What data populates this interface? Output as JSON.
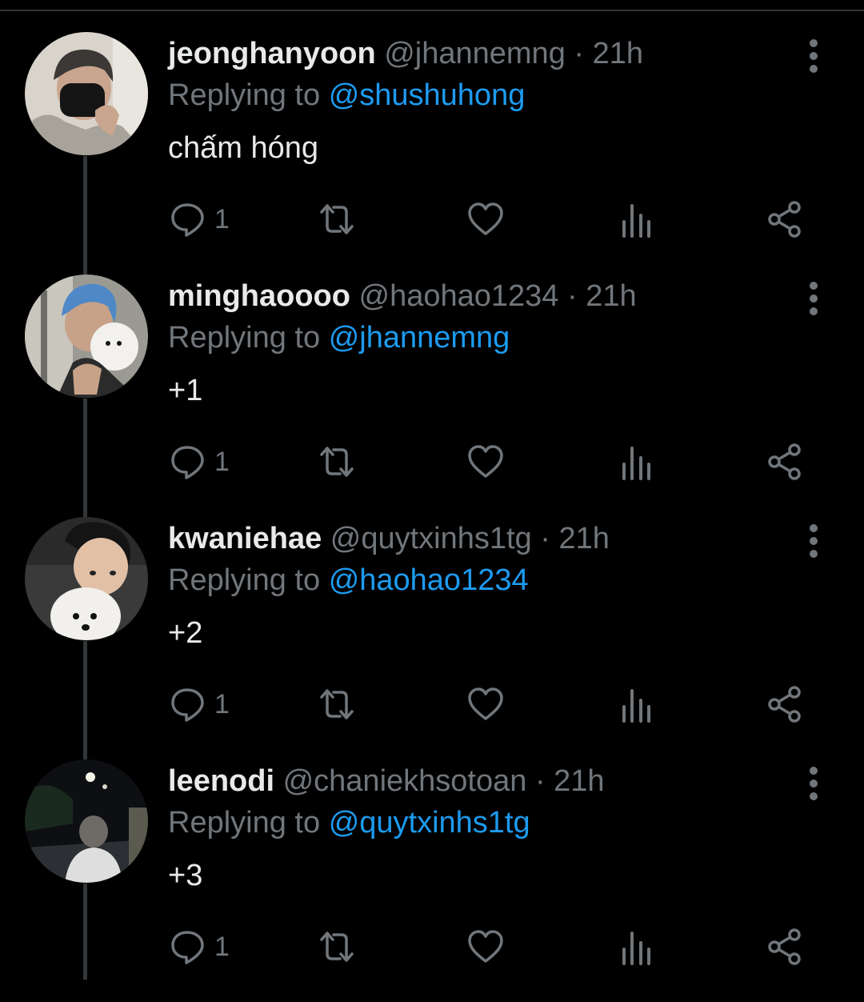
{
  "colors": {
    "background": "#000000",
    "text": "#e7e9ea",
    "muted": "#71767b",
    "link": "#1d9bf0",
    "line": "#333639"
  },
  "replying_label": "Replying to",
  "tweets": [
    {
      "name": "jeonghanyoon",
      "handle": "@jhannemng",
      "dot": "·",
      "time": "21h",
      "reply_to": "@shushuhong",
      "text": "chấm hóng",
      "reply_count": "1",
      "avatar": "avatar-grey-hoodie-mask"
    },
    {
      "name": "minghaoooo",
      "handle": "@haohao1234",
      "dot": "·",
      "time": "21h",
      "reply_to": "@jhannemng",
      "text": "+1",
      "reply_count": "1",
      "avatar": "avatar-blue-hair-dog"
    },
    {
      "name": "kwaniehae",
      "handle": "@quytxinhs1tg",
      "dot": "·",
      "time": "21h",
      "reply_to": "@haohao1234",
      "text": "+2",
      "reply_count": "1",
      "avatar": "avatar-man-white-dog"
    },
    {
      "name": "leenodi",
      "handle": "@chaniekhsotoan",
      "dot": "·",
      "time": "21h",
      "reply_to": "@quytxinhs1tg",
      "text": "+3",
      "reply_count": "1",
      "avatar": "avatar-night-street"
    }
  ],
  "icons": {
    "reply": "reply-icon",
    "retweet": "retweet-icon",
    "like": "like-icon",
    "views": "views-icon",
    "share": "share-icon",
    "more": "more-icon"
  }
}
